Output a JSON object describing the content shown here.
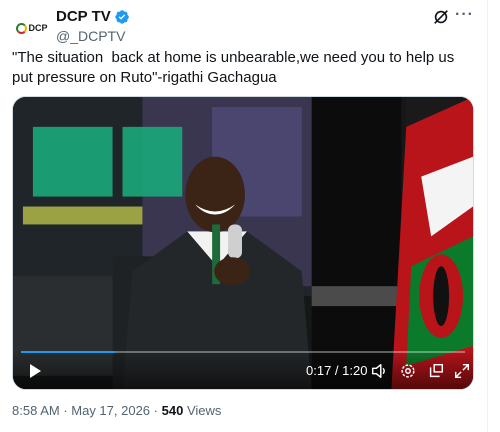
{
  "account": {
    "avatar_text": "DCP",
    "display_name": "DCP TV",
    "handle": "@_DCPTV"
  },
  "icons": {
    "verified": "verified-badge-icon",
    "grok": "grok-icon",
    "more": "more-icon",
    "play": "play-icon",
    "volume": "volume-icon",
    "settings": "settings-icon",
    "popout": "popout-icon",
    "fullscreen": "fullscreen-icon"
  },
  "colors": {
    "accent": "#1d9bf0",
    "text": "#0f1419",
    "muted": "#536471"
  },
  "tweet": {
    "text": "\"The situation  back at home is unbearable,we need you to help us put pressure on Ruto\"-rigathi Gachagua"
  },
  "video": {
    "elapsed": "0:17",
    "duration": "1:20",
    "time_display": "0:17 / 1:20",
    "progress_fraction": 0.2125
  },
  "meta": {
    "time": "8:58 AM",
    "date": "May 17, 2026",
    "separator": " · ",
    "views_count": "540",
    "views_label": "Views"
  }
}
